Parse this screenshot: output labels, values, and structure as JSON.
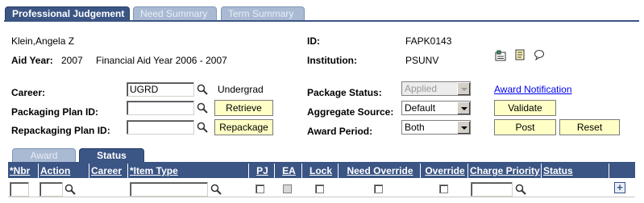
{
  "tabs": [
    {
      "label": "Professional Judgement",
      "active": true
    },
    {
      "label": "Need Summary",
      "active": false
    },
    {
      "label": "Term Summary",
      "active": false
    }
  ],
  "header": {
    "student_name": "Klein,Angela Z",
    "aid_year_label": "Aid Year:",
    "aid_year_value": "2007",
    "aid_year_desc": "Financial Aid Year 2006 - 2007",
    "id_label": "ID:",
    "id_value": "FAPK0143",
    "institution_label": "Institution:",
    "institution_value": "PSUNV"
  },
  "toolbar_icons": [
    "student-services-icon",
    "notepad-icon",
    "comments-icon"
  ],
  "form": {
    "career_label": "Career:",
    "career_value": "UGRD",
    "career_desc": "Undergrad",
    "packaging_plan_label": "Packaging Plan ID:",
    "packaging_plan_value": "",
    "repackaging_plan_label": "Repackaging Plan ID:",
    "repackaging_plan_value": "",
    "retrieve_label": "Retrieve",
    "repackage_label": "Repackage",
    "package_status_label": "Package Status:",
    "package_status_value": "Applied",
    "aggregate_source_label": "Aggregate Source:",
    "aggregate_source_value": "Default",
    "award_period_label": "Award Period:",
    "award_period_value": "Both",
    "award_notification_link": "Award Notification",
    "validate_label": "Validate",
    "post_label": "Post",
    "reset_label": "Reset"
  },
  "grid": {
    "tabs": [
      {
        "label": "Award",
        "active": false
      },
      {
        "label": "Status",
        "active": true
      }
    ],
    "columns": [
      "*Nbr",
      "Action",
      "Career",
      "*Item Type",
      "PJ",
      "EA",
      "Lock",
      "Need Override",
      "Override",
      "Charge Priority",
      "Status"
    ],
    "row": {
      "nbr": "",
      "action": "",
      "item_type": "",
      "charge_priority": ""
    }
  },
  "colors": {
    "accent": "#3b5584",
    "button_bg": "#ffffc6",
    "tab_inactive": "#aabad3",
    "link": "#0000ee"
  }
}
